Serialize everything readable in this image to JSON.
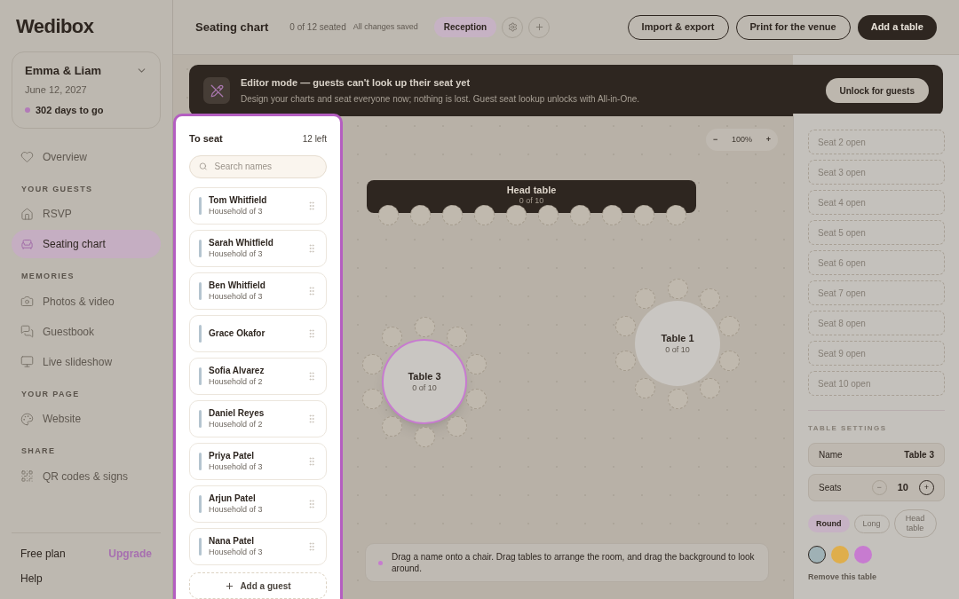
{
  "sidebar": {
    "logo": "Wedibox",
    "event": {
      "name": "Emma & Liam",
      "date": "June 12, 2027",
      "countdown": "302 days to go"
    },
    "sections": [
      {
        "items": [
          {
            "label": "Overview",
            "selected": false
          }
        ]
      },
      {
        "heading": "YOUR GUESTS",
        "items": [
          {
            "label": "RSVP",
            "selected": false
          },
          {
            "label": "Seating chart",
            "selected": true
          }
        ]
      },
      {
        "heading": "MEMORIES",
        "items": [
          {
            "label": "Photos & video",
            "selected": false
          },
          {
            "label": "Guestbook",
            "selected": false
          },
          {
            "label": "Live slideshow",
            "selected": false
          }
        ]
      },
      {
        "heading": "YOUR PAGE",
        "items": [
          {
            "label": "Website",
            "selected": false
          }
        ]
      },
      {
        "heading": "SHARE",
        "items": [
          {
            "label": "QR codes & signs",
            "selected": false
          }
        ]
      }
    ],
    "plan": "Free plan",
    "upgrade": "Upgrade",
    "help": "Help"
  },
  "topbar": {
    "title": "Seating chart",
    "seated": "0 of 12 seated",
    "saved": "All changes saved",
    "rooms": [
      {
        "label": "Reception",
        "selected": true
      }
    ],
    "buttons": [
      {
        "label": "Import & export",
        "kind": "outline"
      },
      {
        "label": "Print for the venue",
        "kind": "outline"
      },
      {
        "label": "Add a table",
        "kind": "primary"
      }
    ]
  },
  "banner": {
    "title": "Editor mode — guests can't look up their seat yet",
    "text": "Design your charts and seat everyone now; nothing is lost. Guest seat lookup unlocks with All-in-One.",
    "button": "Unlock for guests"
  },
  "to_seat": {
    "title": "To seat",
    "count": "12 left",
    "search_placeholder": "Search names",
    "guests": [
      {
        "name": "Tom Whitfield",
        "household": "Household of 3"
      },
      {
        "name": "Sarah Whitfield",
        "household": "Household of 3"
      },
      {
        "name": "Ben Whitfield",
        "household": "Household of 3"
      },
      {
        "name": "Grace Okafor"
      },
      {
        "name": "Sofia Alvarez",
        "household": "Household of 2"
      },
      {
        "name": "Daniel Reyes",
        "household": "Household of 2"
      },
      {
        "name": "Priya Patel",
        "household": "Household of 3"
      },
      {
        "name": "Arjun Patel",
        "household": "Household of 3"
      },
      {
        "name": "Nana Patel",
        "household": "Household of 3"
      }
    ],
    "add": "Add a guest"
  },
  "canvas": {
    "zoom_out": "−",
    "zoom": "100%",
    "zoom_in": "+",
    "tables": [
      {
        "name": "Head table",
        "count": "0 of 10",
        "kind": "long",
        "selected": false
      },
      {
        "name": "Table 1",
        "count": "0 of 10",
        "kind": "round",
        "selected": false
      },
      {
        "name": "Table 3",
        "count": "0 of 10",
        "kind": "round",
        "selected": true
      }
    ],
    "hint": "Drag a name onto a chair. Drag tables to arrange the room, and drag the background to look around."
  },
  "side_panel": {
    "seats": [
      "Seat 2 open",
      "Seat 3 open",
      "Seat 4 open",
      "Seat 5 open",
      "Seat 6 open",
      "Seat 7 open",
      "Seat 8 open",
      "Seat 9 open",
      "Seat 10 open"
    ],
    "settings_heading": "TABLE SETTINGS",
    "name_label": "Name",
    "name_value": "Table 3",
    "seats_label": "Seats",
    "seats_value": "10",
    "minus": "−",
    "plus": "+",
    "shapes": [
      {
        "label": "Round",
        "selected": true
      },
      {
        "label": "Long",
        "selected": false
      },
      {
        "label": "Head table",
        "selected": false
      }
    ],
    "colors": [
      {
        "color": "#9fb1b5",
        "selected": true
      },
      {
        "color": "#dfae4c",
        "selected": false
      },
      {
        "color": "#c77bd0",
        "selected": false
      }
    ],
    "remove": "Remove this table"
  }
}
